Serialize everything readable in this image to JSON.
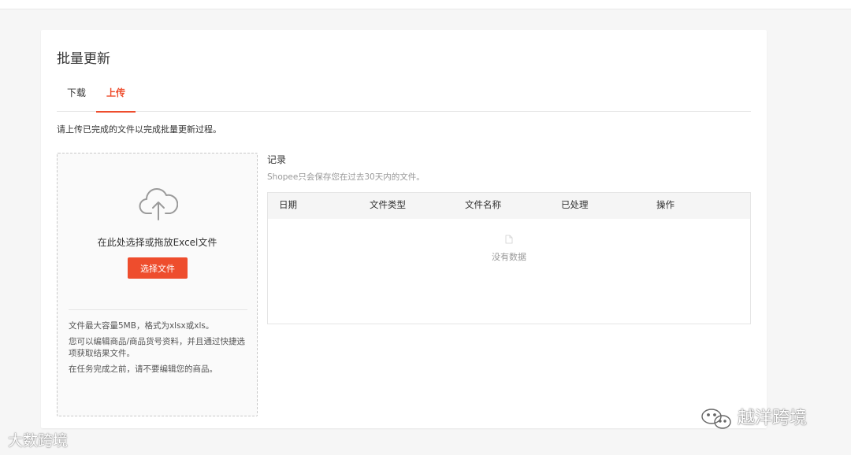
{
  "page": {
    "title": "批量更新",
    "tabs": [
      {
        "label": "下载",
        "active": false
      },
      {
        "label": "上传",
        "active": true
      }
    ],
    "instruction": "请上传已完成的文件以完成批量更新过程。"
  },
  "upload": {
    "icon": "cloud-upload-icon",
    "drop_text": "在此处选择或拖放Excel文件",
    "button_label": "选择文件",
    "notes": [
      "文件最大容量5MB，格式为xlsx或xls。",
      "您可以编辑商品/商品货号资料，并且通过快捷选项获取结果文件。",
      "在任务完成之前，请不要编辑您的商品。"
    ]
  },
  "records": {
    "title": "记录",
    "subtitle": "Shopee只会保存您在过去30天内的文件。",
    "columns": [
      "日期",
      "文件类型",
      "文件名称",
      "已处理",
      "操作"
    ],
    "empty_text": "没有数据"
  },
  "watermarks": {
    "left": "大数跨境",
    "right": "越洋跨境"
  },
  "colors": {
    "accent": "#ee4d2d",
    "muted_text": "#999999",
    "border": "#e5e5e5"
  }
}
